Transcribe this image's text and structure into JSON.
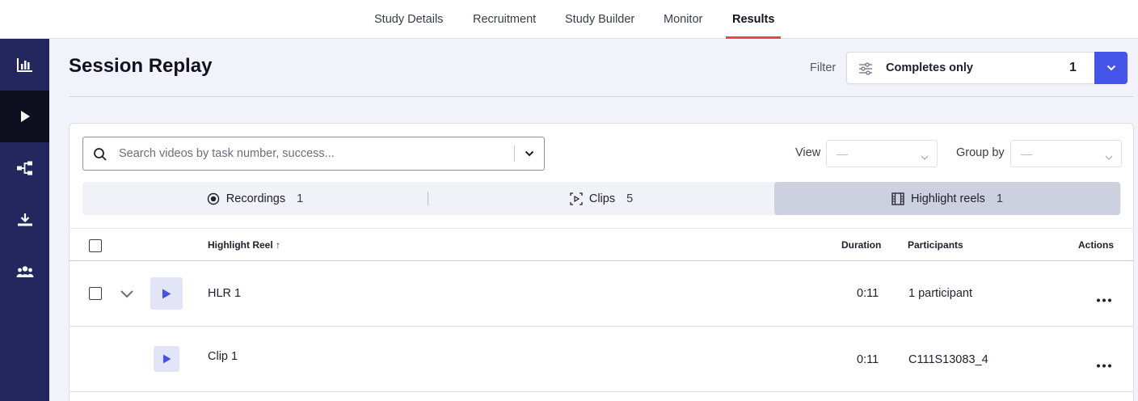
{
  "nav": {
    "tabs": [
      {
        "label": "Study Details"
      },
      {
        "label": "Recruitment"
      },
      {
        "label": "Study Builder"
      },
      {
        "label": "Monitor"
      },
      {
        "label": "Results"
      }
    ],
    "active_tab": "Results"
  },
  "sidebar": {
    "items": [
      {
        "icon": "bar-chart-icon"
      },
      {
        "icon": "play-icon",
        "active": true
      },
      {
        "icon": "flow-icon"
      },
      {
        "icon": "download-icon"
      },
      {
        "icon": "participants-icon"
      }
    ]
  },
  "page": {
    "title": "Session Replay",
    "filter_label": "Filter",
    "filter_value": "Completes only",
    "filter_count": "1"
  },
  "search": {
    "placeholder": "Search videos by task number, success..."
  },
  "view": {
    "label": "View",
    "value": "—"
  },
  "group_by": {
    "label": "Group by",
    "value": "—"
  },
  "segments": [
    {
      "label": "Recordings",
      "count": "1",
      "icon": "record-icon"
    },
    {
      "label": "Clips",
      "count": "5",
      "icon": "clip-icon"
    },
    {
      "label": "Highlight reels",
      "count": "1",
      "icon": "film-icon",
      "active": true
    }
  ],
  "table": {
    "columns": {
      "name": "Highlight Reel",
      "sort_arrow": "↑",
      "duration": "Duration",
      "participants": "Participants",
      "actions": "Actions"
    },
    "rows": [
      {
        "name": "HLR 1",
        "duration": "0:11",
        "participants": "1 participant",
        "expanded": true
      },
      {
        "name": "Clip 1",
        "duration": "0:11",
        "participants": "C111S13083_4",
        "child": true
      }
    ]
  },
  "colors": {
    "accent": "#4453e8",
    "active_tab_underline": "#e8493f",
    "sidebar_bg": "#24275e",
    "sidebar_active": "#0e0f1e"
  }
}
